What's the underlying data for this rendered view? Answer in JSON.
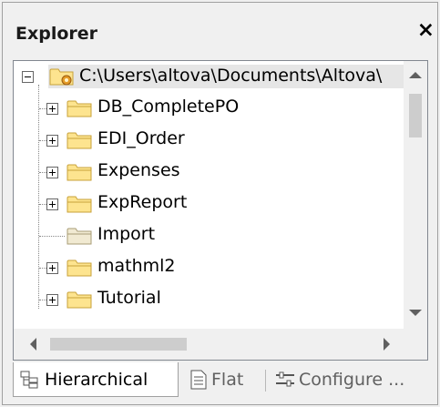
{
  "panel": {
    "title": "Explorer",
    "close_label": "×"
  },
  "tree": {
    "root": {
      "label": "C:\\Users\\altova\\Documents\\Altova\\",
      "icon": "config-folder-icon",
      "expanded": true
    },
    "items": [
      {
        "label": "DB_CompletePO",
        "expandable": true
      },
      {
        "label": "EDI_Order",
        "expandable": true
      },
      {
        "label": "Expenses",
        "expandable": true
      },
      {
        "label": "ExpReport",
        "expandable": true
      },
      {
        "label": "Import",
        "expandable": false
      },
      {
        "label": "mathml2",
        "expandable": true
      },
      {
        "label": "Tutorial",
        "expandable": true
      }
    ]
  },
  "tabs": [
    {
      "label": "Hierarchical",
      "active": true,
      "icon": "hierarchy-icon"
    },
    {
      "label": "Flat",
      "active": false,
      "icon": "document-icon"
    },
    {
      "label": "Configure ...",
      "active": false,
      "icon": "settings-sliders-icon"
    }
  ],
  "colors": {
    "folder_fill": "#fde48f",
    "folder_stroke": "#c8a23a",
    "selection": "#e6e6e6"
  }
}
